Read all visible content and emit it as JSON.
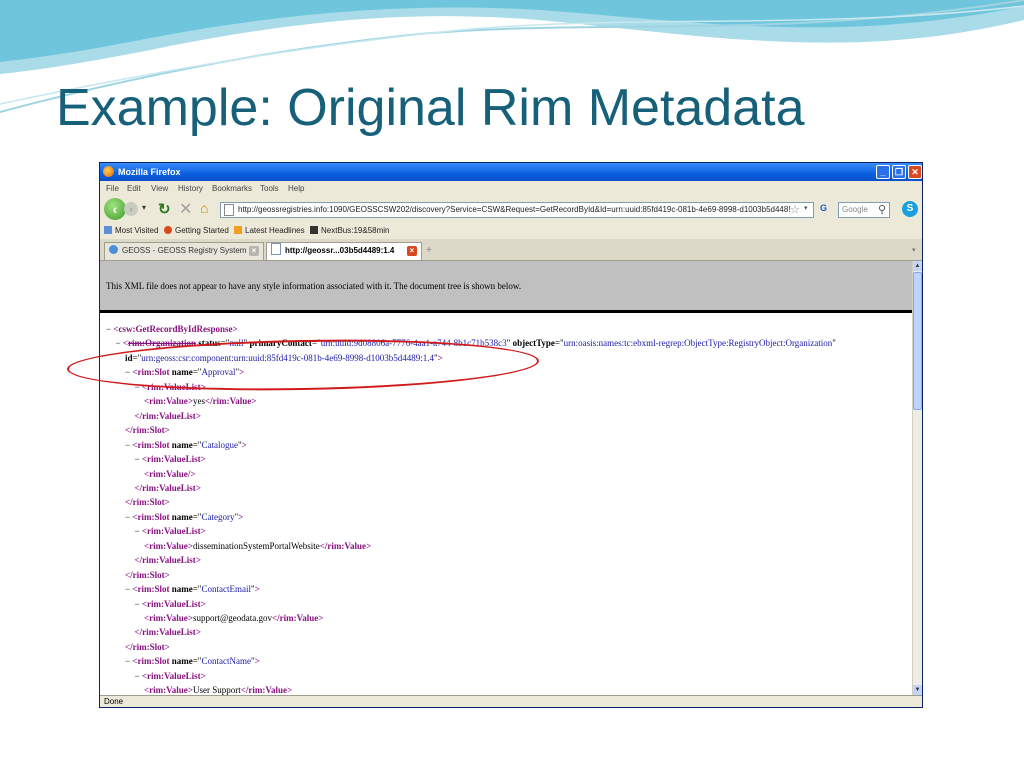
{
  "slide": {
    "title": "Example: Original Rim Metadata",
    "colors": {
      "title": "#17607a",
      "wave": "#6fc6dc",
      "annotation": "#d11b1b"
    }
  },
  "window": {
    "title": "Mozilla Firefox",
    "controls": {
      "minimize": "_",
      "maximize": "❐",
      "close": "✕"
    },
    "icons": {
      "app": "firefox-icon"
    }
  },
  "menu": {
    "items": [
      "File",
      "Edit",
      "View",
      "History",
      "Bookmarks",
      "Tools",
      "Help"
    ]
  },
  "nav": {
    "url": "http://geossregistries.info:1090/GEOSSCSW202/discovery?Service=CSW&Request=GetRecordById&Id=urn:uuid:85fd419c-081b-4e69-8998-d1003b5d448!",
    "search_placeholder": "Google",
    "search_engine_label": "G",
    "icons": {
      "back": "back-arrow-icon",
      "forward": "forward-arrow-icon",
      "reload": "reload-icon",
      "stop": "stop-icon",
      "home": "home-icon",
      "star": "star-icon",
      "search": "magnifier-icon",
      "skype": "skype-icon"
    }
  },
  "bookmarks": {
    "items": [
      "Most Visited",
      "Getting Started",
      "Latest Headlines",
      "NextBus:19&58min"
    ]
  },
  "tabs": [
    {
      "label": "GEOSS - GEOSS Registry System |...",
      "active": false
    },
    {
      "label": "http://geossr...03b5d4489:1.4",
      "active": true
    }
  ],
  "content": {
    "xml_banner": "This XML file does not appear to have any style information associated with it. The document tree is shown below.",
    "lines": [
      {
        "minus": "− ",
        "open": "<",
        "tag": "csw:GetRecordByIdResponse",
        "close": ">"
      },
      {
        "minus": "− ",
        "open": "<",
        "tag": "rim:Organization",
        "a1n": "status",
        "a1v": "null",
        "a2n": "primaryContact",
        "a2v": "urn:uuid:9d08806a-7776-4aa1-a744-8b1c71b538c3",
        "a3n": "objectType",
        "a3v": "urn:oasis:names:tc:ebxml-regrep:ObjectType:RegistryObject:Organization"
      },
      {
        "a1n": "id",
        "a1v": "urn:geoss:csr:component:urn:uuid:85fd419c-081b-4e69-8998-d1003b5d4489:1.4",
        "close": ">"
      },
      {
        "minus": "− ",
        "open": "<",
        "tag": "rim:Slot",
        "a1n": "name",
        "a1v": "Approval",
        "close": ">"
      },
      {
        "minus": "− ",
        "open": "<",
        "tag": "rim:ValueList",
        "close": ">"
      },
      {
        "open": "<",
        "tag": "rim:Value",
        "text": "yes",
        "endtag": "rim:Value"
      },
      {
        "open": "</",
        "tag": "rim:ValueList",
        "close": ">"
      },
      {
        "open": "</",
        "tag": "rim:Slot",
        "close": ">"
      },
      {
        "minus": "− ",
        "open": "<",
        "tag": "rim:Slot",
        "a1n": "name",
        "a1v": "Catalogue",
        "close": ">"
      },
      {
        "minus": "− ",
        "open": "<",
        "tag": "rim:ValueList",
        "close": ">"
      },
      {
        "open": "<",
        "tag": "rim:Value",
        "close": "/>"
      },
      {
        "open": "</",
        "tag": "rim:ValueList",
        "close": ">"
      },
      {
        "open": "</",
        "tag": "rim:Slot",
        "close": ">"
      },
      {
        "minus": "− ",
        "open": "<",
        "tag": "rim:Slot",
        "a1n": "name",
        "a1v": "Category",
        "close": ">"
      },
      {
        "minus": "− ",
        "open": "<",
        "tag": "rim:ValueList",
        "close": ">"
      },
      {
        "open": "<",
        "tag": "rim:Value",
        "text": "disseminationSystemPortalWebsite",
        "endtag": "rim:Value"
      },
      {
        "open": "</",
        "tag": "rim:ValueList",
        "close": ">"
      },
      {
        "open": "</",
        "tag": "rim:Slot",
        "close": ">"
      },
      {
        "minus": "− ",
        "open": "<",
        "tag": "rim:Slot",
        "a1n": "name",
        "a1v": "ContactEmail",
        "close": ">"
      },
      {
        "minus": "− ",
        "open": "<",
        "tag": "rim:ValueList",
        "close": ">"
      },
      {
        "open": "<",
        "tag": "rim:Value",
        "text": "support@geodata.gov",
        "endtag": "rim:Value"
      },
      {
        "open": "</",
        "tag": "rim:ValueList",
        "close": ">"
      },
      {
        "open": "</",
        "tag": "rim:Slot",
        "close": ">"
      },
      {
        "minus": "− ",
        "open": "<",
        "tag": "rim:Slot",
        "a1n": "name",
        "a1v": "ContactName",
        "close": ">"
      },
      {
        "minus": "− ",
        "open": "<",
        "tag": "rim:ValueList",
        "close": ">"
      },
      {
        "open": "<",
        "tag": "rim:Value",
        "text": "User Support",
        "endtag": "rim:Value"
      }
    ]
  },
  "status": {
    "text": "Done"
  }
}
